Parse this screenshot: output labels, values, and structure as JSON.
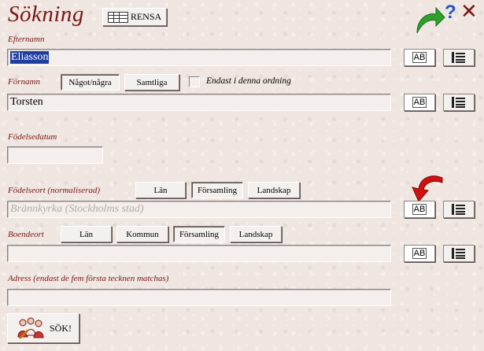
{
  "window": {
    "title": "Sökning"
  },
  "toolbar": {
    "clear_label": "RENSA",
    "help_label": "?",
    "close_label": "✕"
  },
  "lastname": {
    "label": "Efternamn",
    "value": "Eliasson"
  },
  "firstname": {
    "label": "Förnamn",
    "mode_any": "Något/några",
    "mode_all": "Samtliga",
    "order_label": "Endast i denna ordning",
    "value": "Torsten"
  },
  "birthdate": {
    "label": "Födelsedatum",
    "value": ""
  },
  "birthplace": {
    "label": "Födelseort (normaliserad)",
    "opts": [
      "Län",
      "Församling",
      "Landskap"
    ],
    "value": "Brännkyrka (Stockholms stad)"
  },
  "residence": {
    "label": "Boendeort",
    "opts": [
      "Län",
      "Kommun",
      "Församling",
      "Landskap"
    ],
    "value": ""
  },
  "address": {
    "label": "Adress (endast de fem första tecknen matchas)",
    "value": ""
  },
  "search": {
    "label": "SÖK!"
  },
  "ab_icon_text": "AB",
  "colors": {
    "label": "#7a1515",
    "accent_green": "#2fa12b",
    "accent_red": "#d11010",
    "help_blue": "#1f55c9"
  }
}
